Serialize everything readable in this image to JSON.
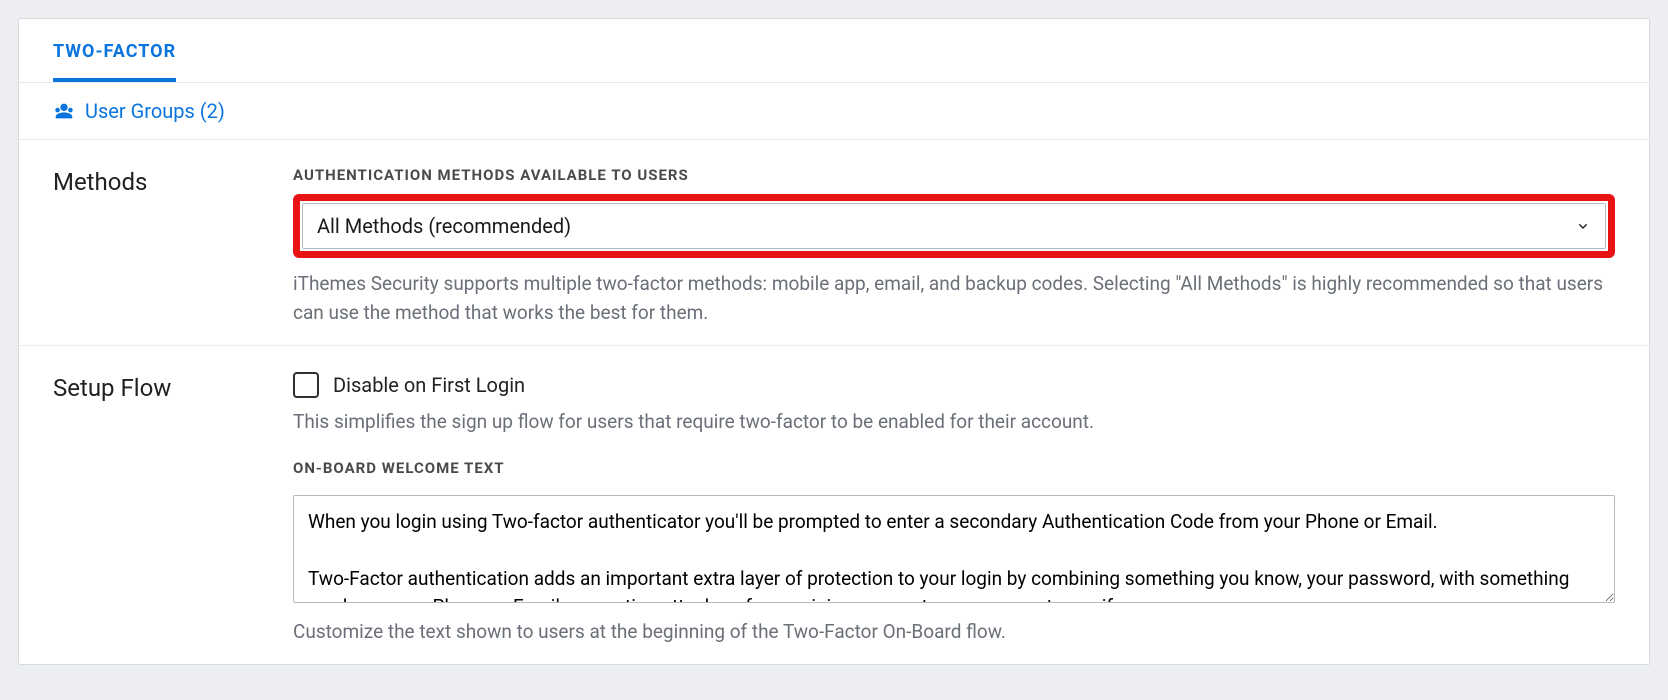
{
  "tabs": {
    "active": "TWO-FACTOR"
  },
  "sublink": {
    "label": "User Groups (2)"
  },
  "methods": {
    "section_title": "Methods",
    "field_label": "AUTHENTICATION METHODS AVAILABLE TO USERS",
    "selected": "All Methods (recommended)",
    "help": "iThemes Security supports multiple two-factor methods: mobile app, email, and backup codes. Selecting \"All Methods\" is highly recommended so that users can use the method that works the best for them."
  },
  "setup_flow": {
    "section_title": "Setup Flow",
    "disable_first_login_label": "Disable on First Login",
    "disable_first_login_checked": false,
    "disable_first_login_help": "This simplifies the sign up flow for users that require two-factor to be enabled for their account.",
    "onboard_label": "ON-BOARD WELCOME TEXT",
    "onboard_text": "When you login using Two-factor authenticator you'll be prompted to enter a secondary Authentication Code from your Phone or Email.\n\nTwo-Factor authentication adds an important extra layer of protection to your login by combining something you know, your password, with something you have, your Phone or Email, preventing attackers from gaining access to your account even if you",
    "onboard_help": "Customize the text shown to users at the beginning of the Two-Factor On-Board flow."
  }
}
